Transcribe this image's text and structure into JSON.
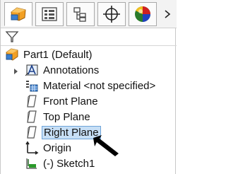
{
  "tree": {
    "root": "Part1  (Default)",
    "items": [
      {
        "label": "Annotations",
        "icon": "annotations-icon"
      },
      {
        "label": "Material <not specified>",
        "icon": "material-icon"
      },
      {
        "label": "Front Plane",
        "icon": "plane-icon"
      },
      {
        "label": "Top Plane",
        "icon": "plane-icon"
      },
      {
        "label": "Right Plane",
        "icon": "plane-icon"
      },
      {
        "label": "Origin",
        "icon": "origin-icon"
      },
      {
        "label": "(-) Sketch1",
        "icon": "sketch-icon"
      }
    ]
  },
  "colors": {
    "selection": "#c7dff6",
    "selection_border": "#6ea3d8",
    "accent_orange": "#f0a020"
  }
}
